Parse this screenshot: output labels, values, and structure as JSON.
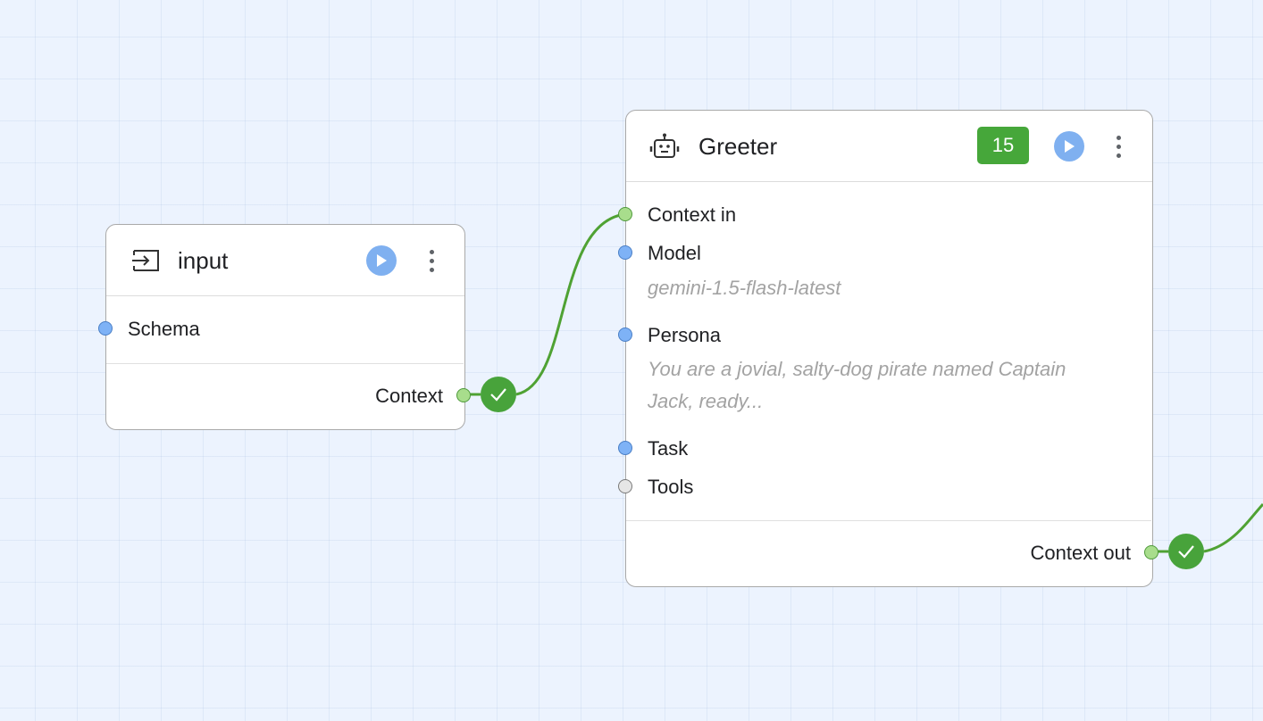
{
  "canvas": {
    "wire_color": "#4fa233",
    "port_colors": {
      "input": "#7eb2f6",
      "context": "#a8dd8c",
      "optional": "#e6e6e6"
    }
  },
  "input_node": {
    "icon": "input-arrow-icon",
    "title": "input",
    "ports_in": [
      {
        "label": "Schema",
        "type": "input"
      }
    ],
    "ports_out": [
      {
        "label": "Context",
        "type": "context",
        "status": "check-icon"
      }
    ]
  },
  "greeter_node": {
    "icon": "robot-icon",
    "title": "Greeter",
    "badge": "15",
    "badge_color": "#46a73a",
    "ports_in": [
      {
        "label": "Context in",
        "type": "context"
      },
      {
        "label": "Model",
        "type": "input",
        "value": "gemini-1.5-flash-latest"
      },
      {
        "label": "Persona",
        "type": "input",
        "value_line1": "You are a jovial, salty-dog pirate named Captain",
        "value_line2": "Jack, ready..."
      },
      {
        "label": "Task",
        "type": "input"
      },
      {
        "label": "Tools",
        "type": "optional"
      }
    ],
    "ports_out": [
      {
        "label": "Context out",
        "type": "context",
        "status": "check-icon"
      }
    ]
  }
}
